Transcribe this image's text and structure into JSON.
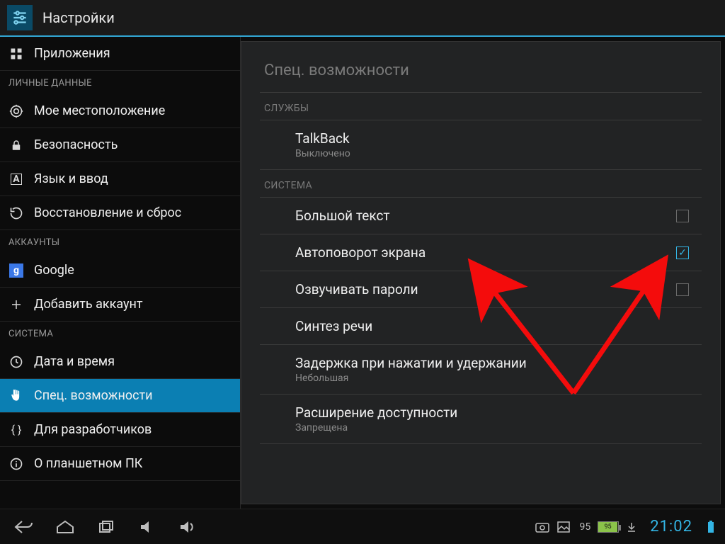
{
  "titlebar": {
    "title": "Настройки"
  },
  "sidebar": {
    "top_item": {
      "label": "Приложения"
    },
    "sections": [
      {
        "header": "ЛИЧНЫЕ ДАННЫЕ",
        "items": [
          {
            "id": "location",
            "label": "Мое местоположение"
          },
          {
            "id": "security",
            "label": "Безопасность"
          },
          {
            "id": "language",
            "label": "Язык и ввод"
          },
          {
            "id": "backup",
            "label": "Восстановление и сброс"
          }
        ]
      },
      {
        "header": "АККАУНТЫ",
        "items": [
          {
            "id": "google",
            "label": "Google"
          },
          {
            "id": "add-account",
            "label": "Добавить аккаунт"
          }
        ]
      },
      {
        "header": "СИСТЕМА",
        "items": [
          {
            "id": "datetime",
            "label": "Дата и время"
          },
          {
            "id": "accessibility",
            "label": "Спец. возможности",
            "selected": true
          },
          {
            "id": "developer",
            "label": "Для разработчиков"
          },
          {
            "id": "about",
            "label": "О планшетном ПК"
          }
        ]
      }
    ]
  },
  "detail": {
    "page_title": "Спец. возможности",
    "groups": [
      {
        "header": "СЛУЖБЫ",
        "rows": [
          {
            "id": "talkback",
            "title": "TalkBack",
            "sub": "Выключено"
          }
        ]
      },
      {
        "header": "СИСТЕМА",
        "rows": [
          {
            "id": "large-text",
            "title": "Большой текст",
            "checkbox": true,
            "checked": false
          },
          {
            "id": "auto-rotate",
            "title": "Автоповорот экрана",
            "checkbox": true,
            "checked": true
          },
          {
            "id": "speak-pass",
            "title": "Озвучивать пароли",
            "checkbox": true,
            "checked": false
          },
          {
            "id": "tts",
            "title": "Синтез речи"
          },
          {
            "id": "touch-delay",
            "title": "Задержка при нажатии и удержании",
            "sub": "Небольшая"
          },
          {
            "id": "access-ext",
            "title": "Расширение доступности",
            "sub": "Запрещена"
          }
        ]
      }
    ]
  },
  "navbar": {
    "battery_percent": "95",
    "battery_pill_text": "95",
    "clock": "21:02"
  },
  "colors": {
    "accent": "#33b5e5",
    "annotation": "#f40c0c"
  }
}
